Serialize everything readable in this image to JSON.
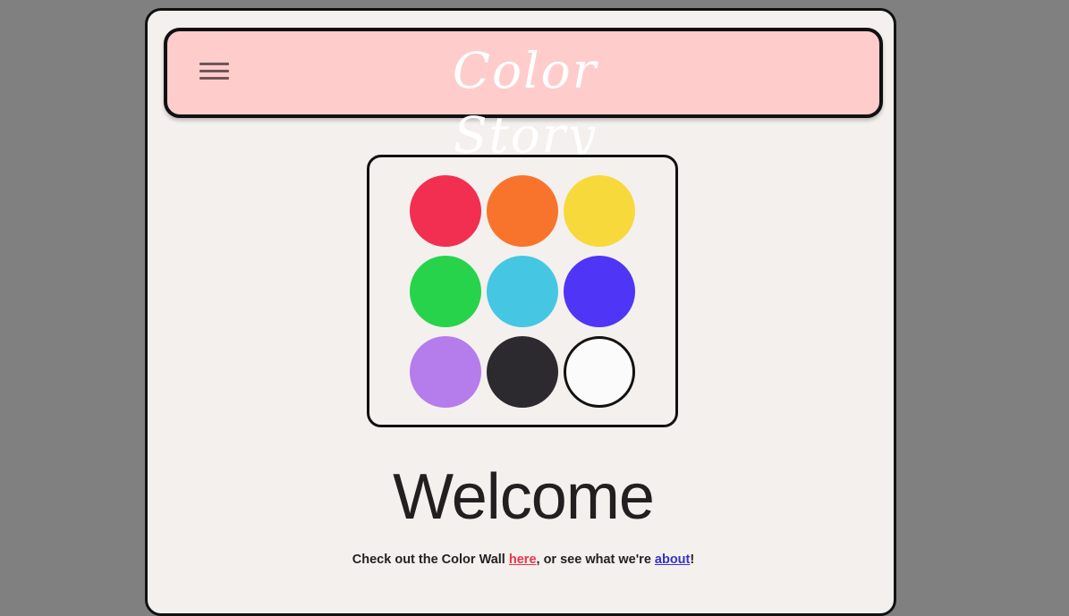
{
  "header": {
    "title": "Color Story",
    "menu_icon": "hamburger-menu-icon"
  },
  "palette": {
    "swatches": [
      {
        "name": "red",
        "color": "#f22f50",
        "outlined": false
      },
      {
        "name": "orange",
        "color": "#f8742d",
        "outlined": false
      },
      {
        "name": "yellow",
        "color": "#f8d93b",
        "outlined": false
      },
      {
        "name": "green",
        "color": "#27d34b",
        "outlined": false
      },
      {
        "name": "cyan",
        "color": "#45c7e3",
        "outlined": false
      },
      {
        "name": "blue",
        "color": "#4f35f5",
        "outlined": false
      },
      {
        "name": "purple",
        "color": "#b57cec",
        "outlined": false
      },
      {
        "name": "black",
        "color": "#2c2a2f",
        "outlined": false
      },
      {
        "name": "white",
        "color": "#fbfbfb",
        "outlined": true
      }
    ]
  },
  "main": {
    "heading": "Welcome",
    "intro_prefix": "Check out the Color Wall ",
    "here_link": "here",
    "intro_middle": ", or see what we're ",
    "about_link": "about",
    "intro_suffix": "!"
  },
  "colors": {
    "backdrop": "#808080",
    "page": "#f4f0ee",
    "header": "#ffcccc",
    "here_link": "#ef3248",
    "about_link": "#3434c8"
  }
}
